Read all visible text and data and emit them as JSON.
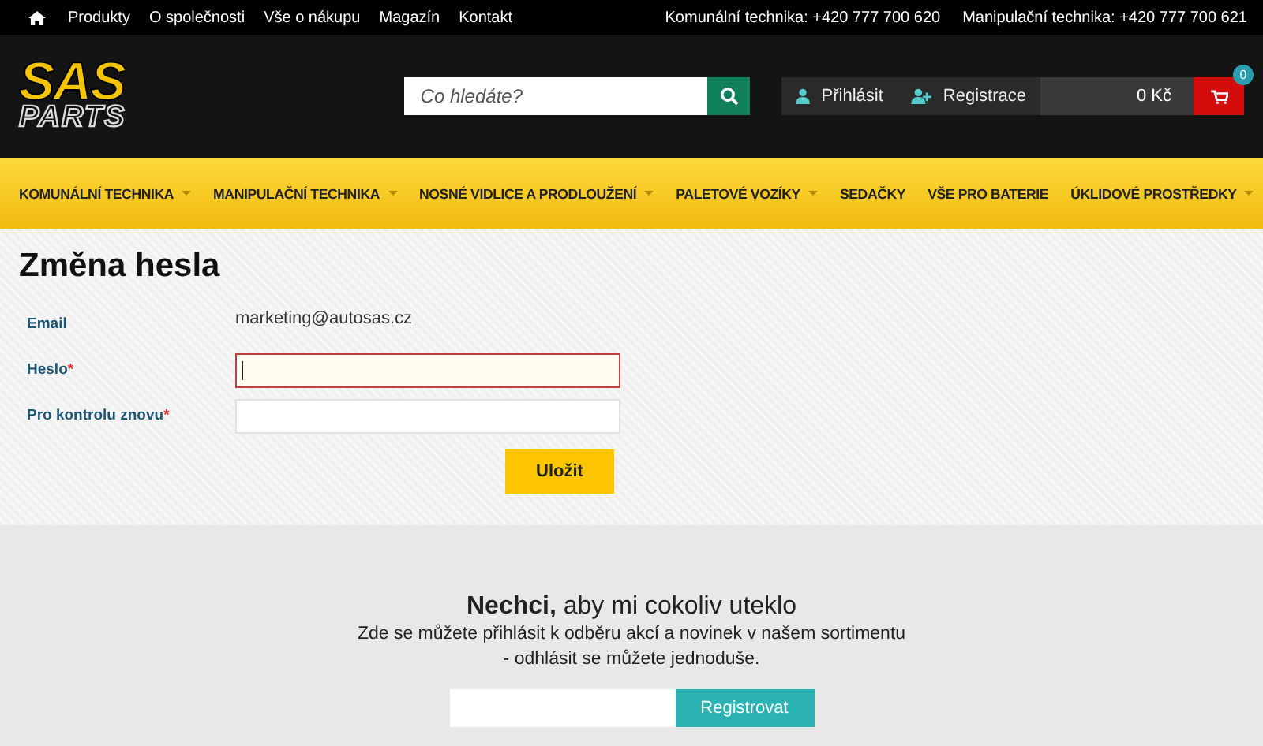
{
  "top_bar": {
    "links": [
      "Produkty",
      "O společnosti",
      "Vše o nákupu",
      "Magazín",
      "Kontakt"
    ],
    "phones": [
      "Komunální technika: +420 777 700 620",
      "Manipulační technika: +420 777 700 621"
    ]
  },
  "header": {
    "logo": {
      "line_1": "SAS",
      "line_2": "PARTS"
    },
    "search": {
      "placeholder": "Co hledáte?"
    },
    "login": "Přihlásit",
    "register": "Registrace",
    "cart_total": "0 Kč",
    "cart_count": "0"
  },
  "nav": [
    {
      "label": "KOMUNÁLNÍ TECHNIKA",
      "has_dropdown": true
    },
    {
      "label": "MANIPULAČNÍ TECHNIKA",
      "has_dropdown": true
    },
    {
      "label": "NOSNÉ VIDLICE A PRODLOUŽENÍ",
      "has_dropdown": true
    },
    {
      "label": "PALETOVÉ VOZÍKY",
      "has_dropdown": true
    },
    {
      "label": "SEDAČKY",
      "has_dropdown": false
    },
    {
      "label": "VŠE PRO BATERIE",
      "has_dropdown": false
    },
    {
      "label": "ÚKLIDOVÉ PROSTŘEDKY",
      "has_dropdown": true
    }
  ],
  "form": {
    "title": "Změna hesla",
    "rows": [
      {
        "kind": "text",
        "label": "Email",
        "value": "marketing@autosas.cz"
      },
      {
        "kind": "input",
        "label": "Heslo",
        "required_mark": "*",
        "invalid": true,
        "focused": true
      },
      {
        "kind": "input",
        "label": "Pro kontrolu znovu",
        "required_mark": "*",
        "invalid": false,
        "focused": false
      }
    ],
    "submit": "Uložit"
  },
  "newsletter": {
    "title": "**Nechci,** aby mi cokoliv uteklo",
    "text": "Zde se můžete přihlásit k odběru akcí a novinek v našem sortimentu",
    "text_2": "- odhlásit se můžete jednoduše.",
    "button": "Registrovat"
  }
}
